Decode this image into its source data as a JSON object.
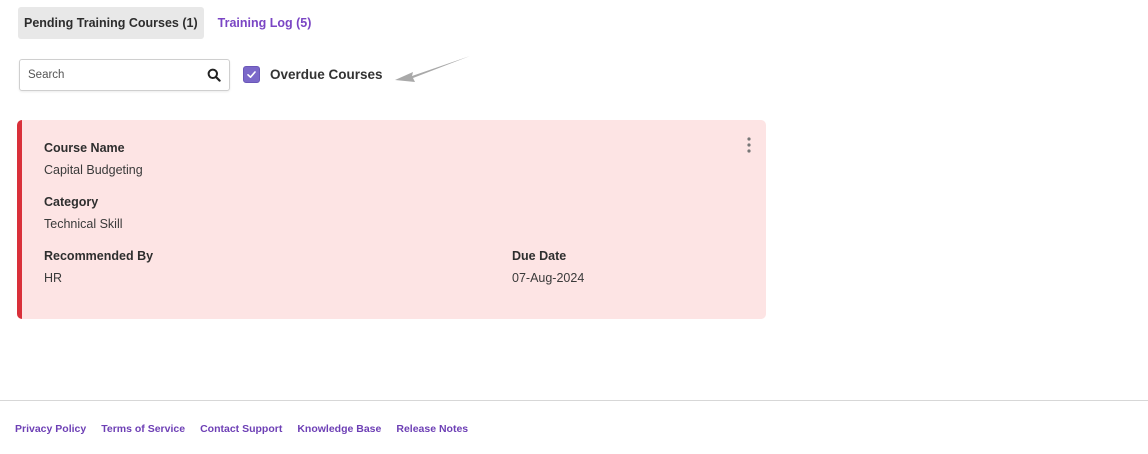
{
  "tabs": [
    {
      "label": "Pending Training Courses (1)",
      "active": true
    },
    {
      "label": "Training Log (5)",
      "active": false
    }
  ],
  "search": {
    "placeholder": "Search",
    "value": "",
    "icon": "search-icon"
  },
  "filter": {
    "label": "Overdue Courses",
    "checked": true
  },
  "course_card": {
    "course_name_label": "Course Name",
    "course_name": "Capital Budgeting",
    "category_label": "Category",
    "category": "Technical Skill",
    "recommended_by_label": "Recommended By",
    "recommended_by": "HR",
    "due_date_label": "Due Date",
    "due_date": "07-Aug-2024"
  },
  "footer": {
    "links": [
      "Privacy Policy",
      "Terms of Service",
      "Contact Support",
      "Knowledge Base",
      "Release Notes"
    ]
  },
  "colors": {
    "accent_purple": "#7a45c4",
    "checkbox": "#7b68c9",
    "card_background": "#fde4e4",
    "card_border": "#d9303a"
  }
}
